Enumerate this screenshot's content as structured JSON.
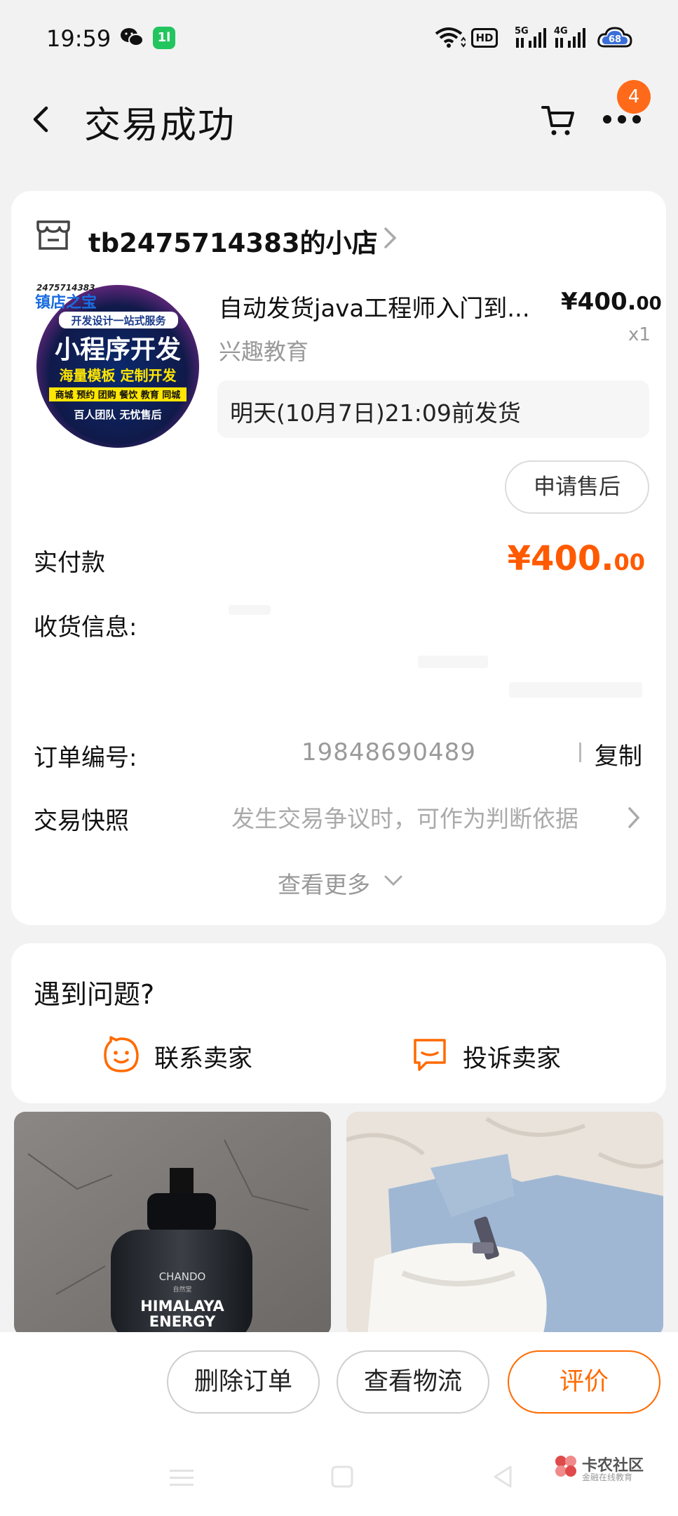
{
  "status_bar": {
    "time": "19:59",
    "app_badge": "1l",
    "hd": "HD",
    "signal_5g": "5G",
    "signal_4g": "4G",
    "battery": "68"
  },
  "header": {
    "title": "交易成功",
    "more_badge": "4"
  },
  "order": {
    "shop_name": "tb2475714383的小店",
    "product": {
      "title": "自动发货java工程师入门到...",
      "sku": "兴趣教育",
      "price_main": "¥400.",
      "price_cents": "00",
      "quantity": "x1",
      "shipping_note": "明天(10月7日)21:09前发货",
      "thumb_top": "2475714383",
      "thumb_brand": "镇店之宝",
      "thumb_tagline": "开发设计一站式服务",
      "thumb_headline": "小程序开发",
      "thumb_sub": "海量模板 定制开发",
      "thumb_tags": "商城 预约 团购 餐饮 教育 同城",
      "thumb_footer": "百人团队 无忧售后"
    },
    "after_sale_label": "申请售后",
    "paid_label": "实付款",
    "paid_main": "¥400.",
    "paid_cents": "00",
    "shipping_info_label": "收货信息:",
    "order_no_label": "订单编号:",
    "order_no": "19848690489",
    "copy_label": "复制",
    "snapshot_label": "交易快照",
    "snapshot_desc": "发生交易争议时，可作为判断依据",
    "see_more": "查看更多"
  },
  "problem": {
    "title": "遇到问题?",
    "contact_seller": "联系卖家",
    "complain_seller": "投诉卖家"
  },
  "recommendations": {
    "left_brand": "CHANDO",
    "left_brand_sub": "自然堂",
    "left_product_line1": "HIMALAYA",
    "left_product_line2": "ENERGY"
  },
  "bottom_bar": {
    "delete_order": "删除订单",
    "view_logistics": "查看物流",
    "review": "评价"
  },
  "watermark": {
    "name": "卡农社区",
    "sub": "金融在线教育"
  },
  "colors": {
    "accent": "#ff5a00",
    "badge": "#ff6a1a",
    "background": "#f2f2f2"
  }
}
